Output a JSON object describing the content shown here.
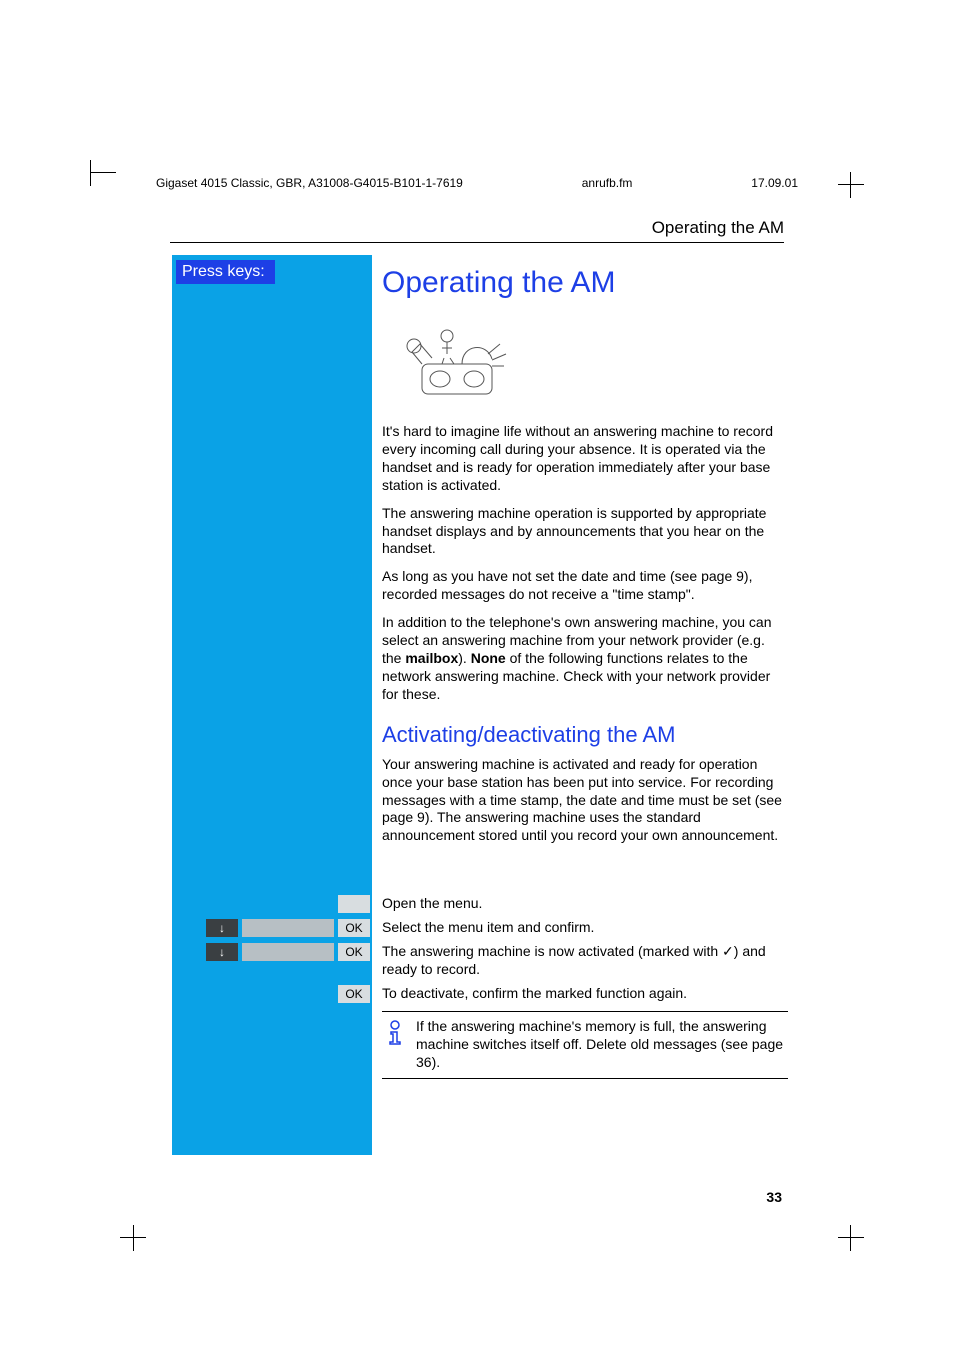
{
  "header": {
    "left": "Gigaset 4015 Classic, GBR, A31008-G4015-B101-1-7619",
    "center": "anrufb.fm",
    "right": "17.09.01"
  },
  "running_head": "Operating the AM",
  "sidebar": {
    "press_keys": "Press keys:"
  },
  "title": "Operating the AM",
  "paras": {
    "p1": "It's hard to imagine life without an answering machine to record every incoming call during your absence. It is operated via the handset and is ready for operation immediately after your base station is activated.",
    "p2": "The answering machine operation is supported by appropriate handset displays and by announcements that you hear on the handset.",
    "p3": "As long as you have not set the date and time (see page 9), recorded messages do not receive a \"time stamp\".",
    "p4a": "In addition to the telephone's own answering machine, you can select an answering machine from your network provider (e.g. the ",
    "p4_bold1": "mailbox",
    "p4b": "). ",
    "p4_bold2": "None",
    "p4c": " of the following functions relates to the network answering machine. Check with your network provider for these."
  },
  "h2": "Activating/deactivating the AM",
  "p5": "Your answering machine is activated and ready for operation once your base station has been put into service. For recording messages with a time stamp, the date and time must be set (see page 9). The answering machine uses the standard announcement stored until you record your own announcement.",
  "steps": {
    "s1": {
      "text": "Open the menu."
    },
    "s2": {
      "ok": "OK",
      "text": "Select the menu item and confirm."
    },
    "s3": {
      "ok": "OK",
      "text_a": "The answering machine is now activated (marked with ",
      "check": "✓",
      "text_b": ") and ready to record."
    },
    "s4": {
      "ok": "OK",
      "text": "To deactivate, confirm the marked function again."
    }
  },
  "note": {
    "text": "If the answering machine's memory is full, the answering machine switches itself off. Delete old messages (see page 36)."
  },
  "page_number": "33"
}
